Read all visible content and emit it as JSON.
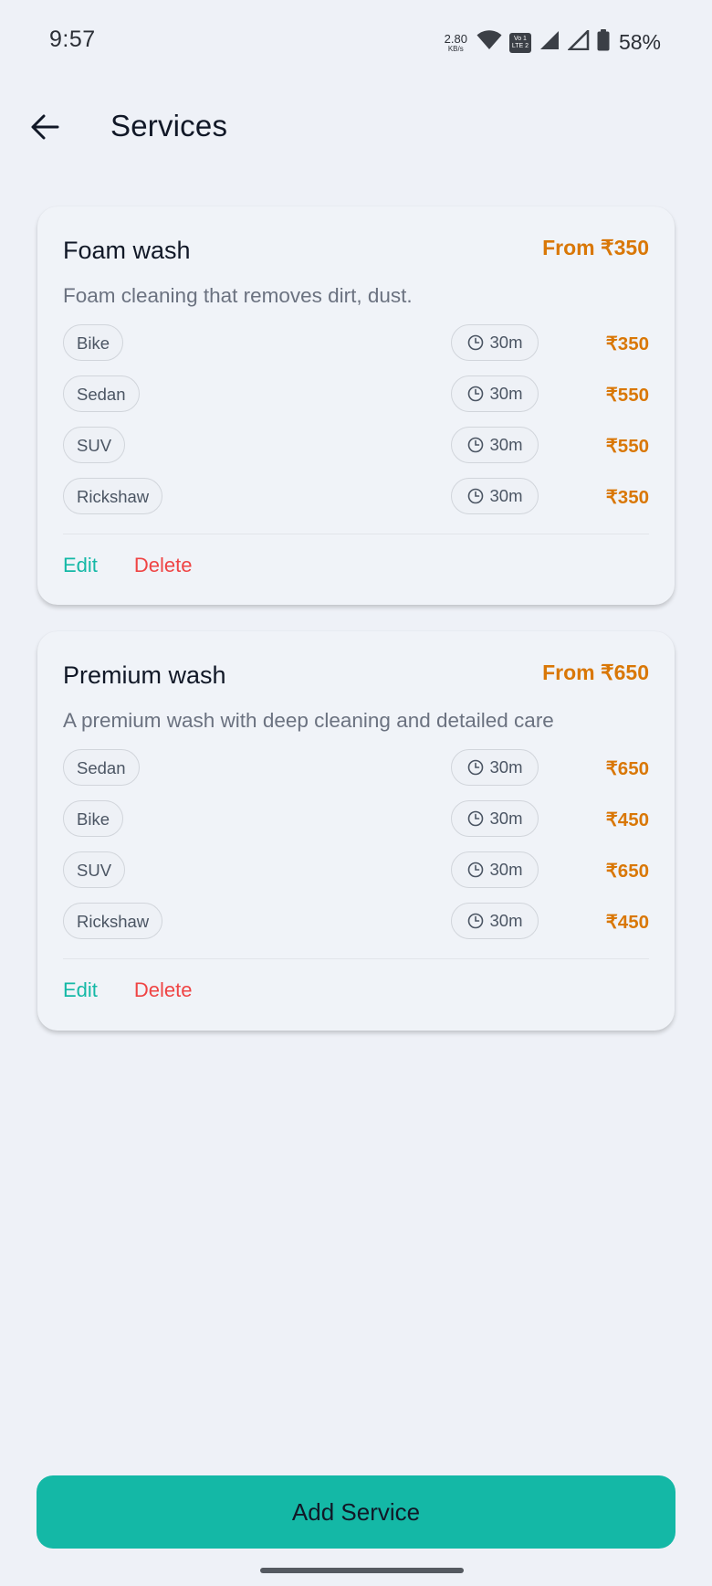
{
  "status_bar": {
    "time": "9:57",
    "net_speed_value": "2.80",
    "net_speed_unit": "KB/s",
    "volte_top": "Vo 1",
    "volte_bottom": "LTE 2",
    "battery_percent": "58%",
    "icons": [
      "wifi-icon",
      "volte-icon",
      "signal-icon",
      "signal-icon",
      "battery-icon"
    ]
  },
  "header": {
    "back_icon": "arrow-left-icon",
    "title": "Services"
  },
  "services": [
    {
      "name": "Foam wash",
      "from_price": "From ₹350",
      "description": "Foam cleaning that removes dirt, dust.",
      "variants": [
        {
          "vehicle": "Bike",
          "duration": "30m",
          "price": "₹350"
        },
        {
          "vehicle": "Sedan",
          "duration": "30m",
          "price": "₹550"
        },
        {
          "vehicle": "SUV",
          "duration": "30m",
          "price": "₹550"
        },
        {
          "vehicle": "Rickshaw",
          "duration": "30m",
          "price": "₹350"
        }
      ],
      "edit_label": "Edit",
      "delete_label": "Delete"
    },
    {
      "name": "Premium wash",
      "from_price": "From ₹650",
      "description": "A premium wash with deep cleaning and detailed care",
      "variants": [
        {
          "vehicle": "Sedan",
          "duration": "30m",
          "price": "₹650"
        },
        {
          "vehicle": "Bike",
          "duration": "30m",
          "price": "₹450"
        },
        {
          "vehicle": "SUV",
          "duration": "30m",
          "price": "₹650"
        },
        {
          "vehicle": "Rickshaw",
          "duration": "30m",
          "price": "₹450"
        }
      ],
      "edit_label": "Edit",
      "delete_label": "Delete"
    }
  ],
  "footer": {
    "add_button_label": "Add Service"
  },
  "colors": {
    "accent": "#14b8a6",
    "price": "#d97706",
    "danger": "#ef4444",
    "background": "#eef1f7"
  }
}
